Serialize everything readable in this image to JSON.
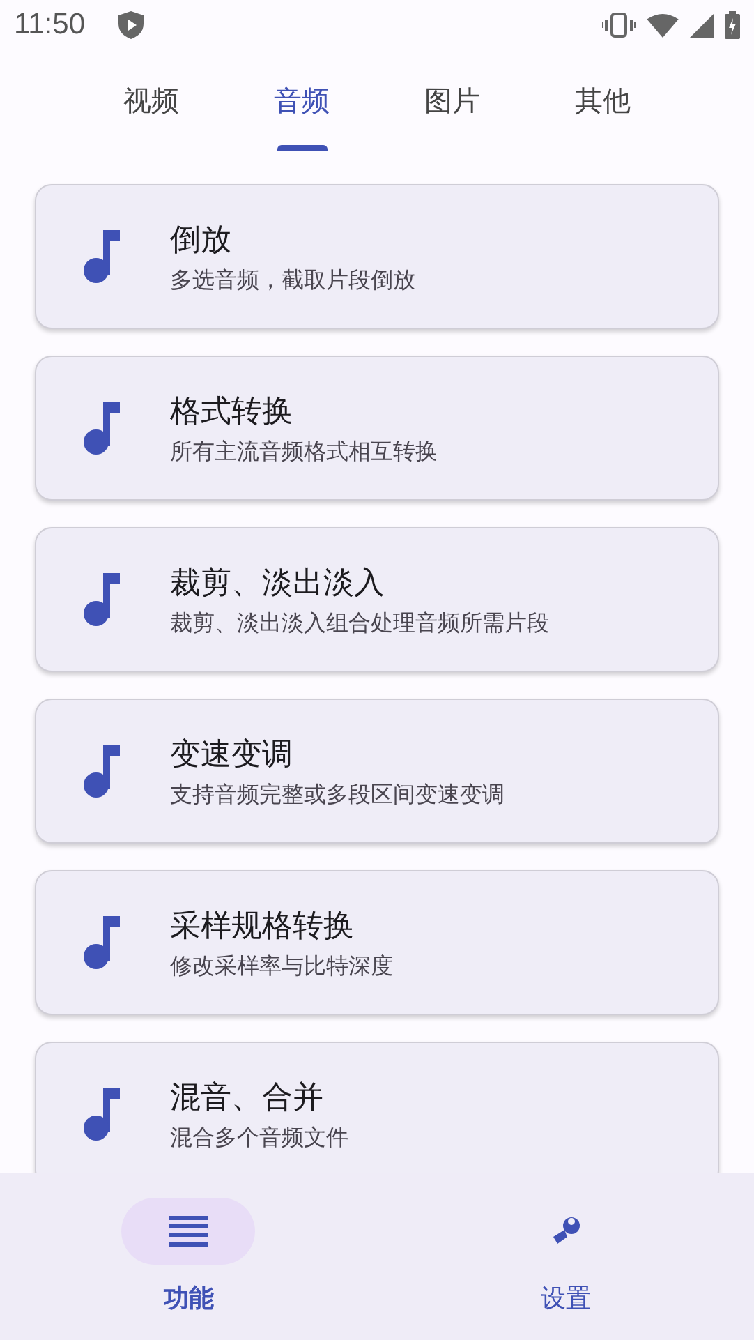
{
  "status_bar": {
    "time": "11:50"
  },
  "tabs": [
    {
      "label": "视频",
      "selected": false
    },
    {
      "label": "音频",
      "selected": true
    },
    {
      "label": "图片",
      "selected": false
    },
    {
      "label": "其他",
      "selected": false
    }
  ],
  "items": [
    {
      "title": "倒放",
      "subtitle": "多选音频，截取片段倒放"
    },
    {
      "title": "格式转换",
      "subtitle": "所有主流音频格式相互转换"
    },
    {
      "title": "裁剪、淡出淡入",
      "subtitle": "裁剪、淡出淡入组合处理音频所需片段"
    },
    {
      "title": "变速变调",
      "subtitle": "支持音频完整或多段区间变速变调"
    },
    {
      "title": "采样规格转换",
      "subtitle": "修改采样率与比特深度"
    },
    {
      "title": "混音、合并",
      "subtitle": "混合多个音频文件"
    }
  ],
  "bottom_nav": [
    {
      "label": "功能",
      "kind": "menu",
      "selected": true
    },
    {
      "label": "设置",
      "kind": "tools",
      "selected": false
    }
  ]
}
